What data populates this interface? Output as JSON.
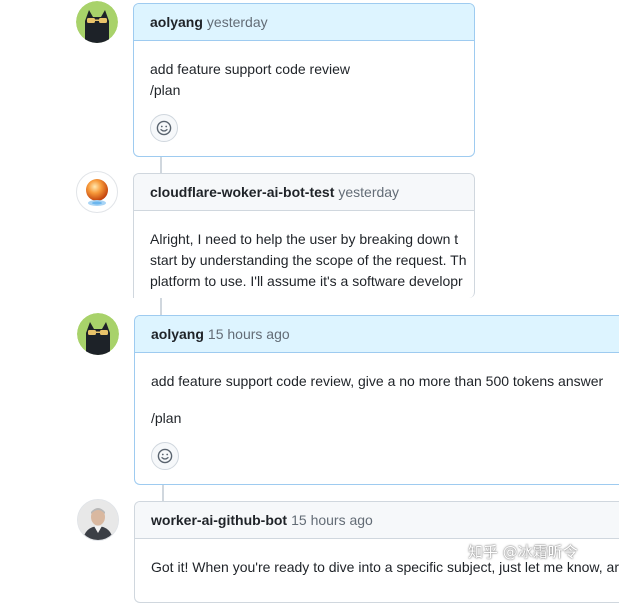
{
  "comments": [
    {
      "author": "aolyang",
      "time": "yesterday",
      "avatar": "sunglasses-cat-avatar",
      "lines": [
        "add feature support code review",
        "/plan"
      ]
    },
    {
      "author": "cloudflare-woker-ai-bot-test",
      "time": "yesterday",
      "avatar": "orange-sphere-avatar",
      "lines": [
        "Alright, I need to help the user by breaking down t",
        "start by understanding the scope of the request. Th",
        "platform to use. I'll assume it's a software developr"
      ]
    },
    {
      "author": "aolyang",
      "time": "15 hours ago",
      "avatar": "sunglasses-cat-avatar",
      "lines": [
        "add feature support code review, give a no more than 500 tokens answer",
        "",
        "/plan"
      ]
    },
    {
      "author": "worker-ai-github-bot",
      "time": "15 hours ago",
      "avatar": "person-photo-avatar",
      "lines": [
        "Got it! When you're ready to dive into a specific subject, just let me know, ar"
      ]
    }
  ],
  "watermark": "知乎 @冰霜听令",
  "colors": {
    "own_header_bg": "#ddf4ff",
    "own_border": "#9ecbf0",
    "other_header_bg": "#f6f8fa",
    "border": "#d0d7de",
    "muted_text": "#636c76"
  }
}
